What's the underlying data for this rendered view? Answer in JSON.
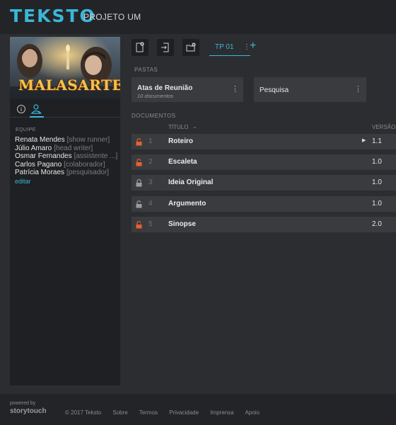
{
  "app": {
    "logo": "TEKSTO",
    "project_title": "PROJETO UM"
  },
  "cover": {
    "title": "MALASARTES"
  },
  "sidebar": {
    "team_label": "EQUIPE",
    "members": [
      {
        "name": "Renata Mendes",
        "role": "[show runner]"
      },
      {
        "name": "Júlio Amaro",
        "role": "[head writer]"
      },
      {
        "name": "Osmar Fernandes",
        "role": "[assistente ...]"
      },
      {
        "name": "Carlos Pagano",
        "role": "[colaborador]"
      },
      {
        "name": "Patrícia Moraes",
        "role": "[pesquisador]"
      }
    ],
    "edit_label": "editar"
  },
  "toolbar": {
    "tab_label": "TP 01",
    "tab_menu": "⋮",
    "add_label": "+"
  },
  "folders": {
    "label": "PASTAS",
    "items": [
      {
        "name": "Atas de Reunião",
        "count": "10 documentos"
      },
      {
        "name": "Pesquisa",
        "count": ""
      }
    ]
  },
  "documents": {
    "label": "DOCUMENTOS",
    "col_title": "TÍTULO",
    "col_version": "VERSÃO",
    "rows": [
      {
        "num": "1",
        "title": "Roteiro",
        "version": "1.1",
        "lock": "unlocked-orange"
      },
      {
        "num": "2",
        "title": "Escaleta",
        "version": "1.0",
        "lock": "unlocked-orange"
      },
      {
        "num": "3",
        "title": "Ideia Original",
        "version": "1.0",
        "lock": "locked-gray"
      },
      {
        "num": "4",
        "title": "Argumento",
        "version": "1.0",
        "lock": "unlocked-gray"
      },
      {
        "num": "5",
        "title": "Sinopse",
        "version": "2.0",
        "lock": "unlocked-orange"
      }
    ]
  },
  "footer": {
    "powered": "powered by",
    "brand": "storytouch",
    "copyright": "© 2017 Tekstо",
    "links": [
      "Sobre",
      "Termos",
      "Privacidade",
      "Imprensa",
      "Apoio"
    ]
  },
  "colors": {
    "accent": "#3ab7d8",
    "lock_orange": "#e8612c",
    "lock_gray": "#9a9b9f"
  }
}
